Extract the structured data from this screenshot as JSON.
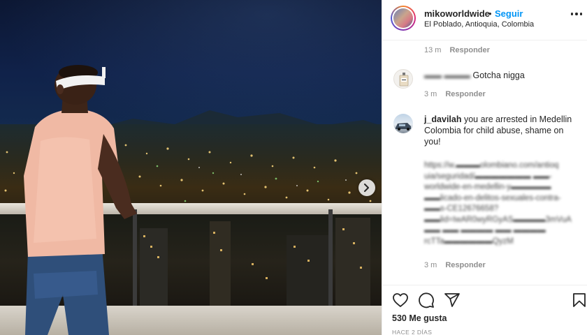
{
  "post": {
    "username": "mikoworldwide",
    "separator": "•",
    "follow_label": "Seguir",
    "location": "El Poblado, Antioquia, Colombia"
  },
  "comments": [
    {
      "time": "13 m",
      "reply_label": "Responder"
    },
    {
      "username_obscured": "▬▬ ▬▬▬",
      "text": "Gotcha nigga",
      "time": "3 m",
      "reply_label": "Responder",
      "avatar_icon": "perfume-bottle-icon"
    },
    {
      "username": "j_davilah",
      "text": "you are arrested in Medellin Colombia for child abuse, shame on you!",
      "time": "3 m",
      "reply_label": "Responder",
      "avatar_icon": "car-photo-icon",
      "blurred_lines": [
        "https://w.▬▬▬olombiano.com/antioq",
        "uia/seguridad/▬▬▬▬▬▬▬ ▬▬-",
        "worldwide-en-medellin-y▬▬▬▬▬",
        "▬▬licado-en-delitos-sexuales-contra-",
        "▬▬s-CE12676658?",
        "▬▬lid=IwAR0wyRGyAS▬▬▬▬3mVuA",
        "▬▬ ▬▬ ▬▬▬▬ ▬▬ ▬▬▬▬",
        "rcTTa▬▬▬▬▬▬QyzM"
      ]
    }
  ],
  "actions": {
    "like_icon": "heart-icon",
    "comment_icon": "comment-icon",
    "share_icon": "share-icon",
    "save_icon": "bookmark-icon",
    "likes_text": "530 Me gusta",
    "date_text": "HACE 2 DÍAS"
  },
  "colors": {
    "link_blue": "#0095f6",
    "text": "#262626",
    "muted": "#8e8e8e"
  }
}
